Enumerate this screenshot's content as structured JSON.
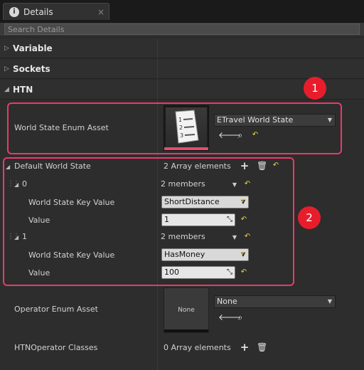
{
  "tab": {
    "label": "Details",
    "close": "×"
  },
  "search": {
    "placeholder": "Search Details"
  },
  "categories": [
    {
      "label": "Variable",
      "arrow": "▷"
    },
    {
      "label": "Sockets",
      "arrow": "▷"
    },
    {
      "label": "HTN",
      "arrow": "◢"
    }
  ],
  "world_state_enum": {
    "label": "World State Enum Asset",
    "value": "ETravel World State",
    "thumbnail_icon": "enum-document-icon"
  },
  "default_world_state": {
    "label": "Default World State",
    "count": "2 Array elements",
    "elements": [
      {
        "index": "0",
        "members": "2 members",
        "key_label": "World State Key Value",
        "key_value": "ShortDistance",
        "value_label": "Value",
        "value": "1"
      },
      {
        "index": "1",
        "members": "2 members",
        "key_label": "World State Key Value",
        "key_value": "HasMoney",
        "value_label": "Value",
        "value": "100"
      }
    ]
  },
  "operator_enum": {
    "label": "Operator Enum Asset",
    "value": "None",
    "thumbnail_text": "None"
  },
  "htn_operator_classes": {
    "label": "HTNOperator Classes",
    "count": "0 Array elements"
  },
  "callouts": [
    "1",
    "2"
  ],
  "colors": {
    "highlight": "#e83b6a",
    "callout": "#e81d2b",
    "reset_arrow": "#e8d44a"
  }
}
